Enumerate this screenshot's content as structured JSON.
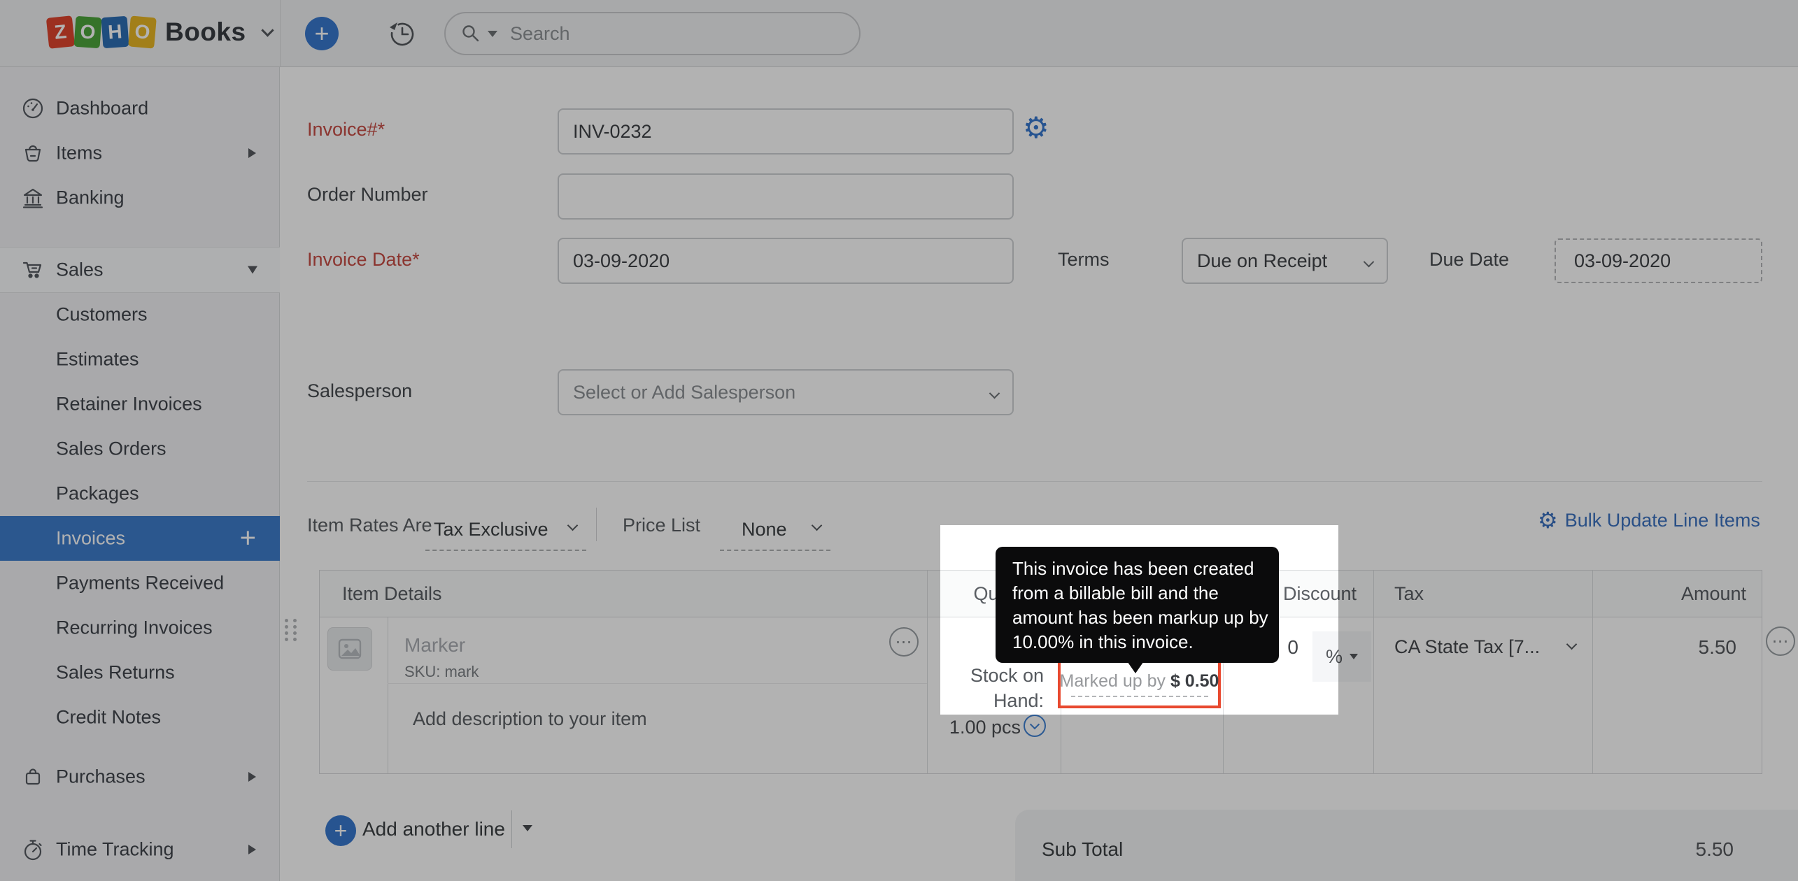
{
  "topbar": {
    "logo_letters": [
      "Z",
      "O",
      "H",
      "O"
    ],
    "logo_text": "Books",
    "search_placeholder": "Search"
  },
  "sidebar": {
    "items": [
      {
        "label": "Dashboard"
      },
      {
        "label": "Items"
      },
      {
        "label": "Banking"
      },
      {
        "label": "Sales"
      },
      {
        "label": "Customers"
      },
      {
        "label": "Estimates"
      },
      {
        "label": "Retainer Invoices"
      },
      {
        "label": "Sales Orders"
      },
      {
        "label": "Packages"
      },
      {
        "label": "Invoices"
      },
      {
        "label": "Payments Received"
      },
      {
        "label": "Recurring Invoices"
      },
      {
        "label": "Sales Returns"
      },
      {
        "label": "Credit Notes"
      },
      {
        "label": "Purchases"
      },
      {
        "label": "Time Tracking"
      }
    ],
    "active_item": "Invoices"
  },
  "form": {
    "invoice_no_label": "Invoice#*",
    "invoice_no_value": "INV-0232",
    "order_number_label": "Order Number",
    "order_number_value": "",
    "invoice_date_label": "Invoice Date*",
    "invoice_date_value": "03-09-2020",
    "terms_label": "Terms",
    "terms_value": "Due on Receipt",
    "due_date_label": "Due Date",
    "due_date_value": "03-09-2020",
    "salesperson_label": "Salesperson",
    "salesperson_placeholder": "Select or Add Salesperson"
  },
  "item_rates": {
    "label": "Item Rates Are",
    "value": "Tax Exclusive",
    "price_list_label": "Price List",
    "price_list_value": "None"
  },
  "bulk_update_label": "Bulk Update Line Items",
  "table": {
    "headers": [
      "Item Details",
      "Quantity",
      "",
      "Discount",
      "Tax",
      "Amount"
    ],
    "row": {
      "item_name": "Marker",
      "sku": "SKU: mark",
      "description_placeholder": "Add description to your item",
      "stock_label": "Stock on Hand:",
      "stock_value": "1.00 pcs",
      "discount_value": "0",
      "discount_unit": "%",
      "tax_value": "CA State Tax [7...",
      "amount": "5.50"
    }
  },
  "tooltip": {
    "lines": [
      "This invoice has been created",
      "from a billable bill and the",
      "amount has been markup up by",
      "10.00% in this invoice."
    ]
  },
  "markup_badge": {
    "label": "Marked up by",
    "value": "$ 0.50"
  },
  "add_line": {
    "label": "Add another line"
  },
  "totals": {
    "subtotal_label": "Sub Total",
    "subtotal_value": "5.50"
  },
  "colors": {
    "accent_blue": "#3979cf",
    "active_sidebar_blue": "#3e7dcc",
    "required_red": "#c84d45",
    "highlight_red": "#e8492f",
    "tooltip_bg": "#0b0b0c"
  }
}
